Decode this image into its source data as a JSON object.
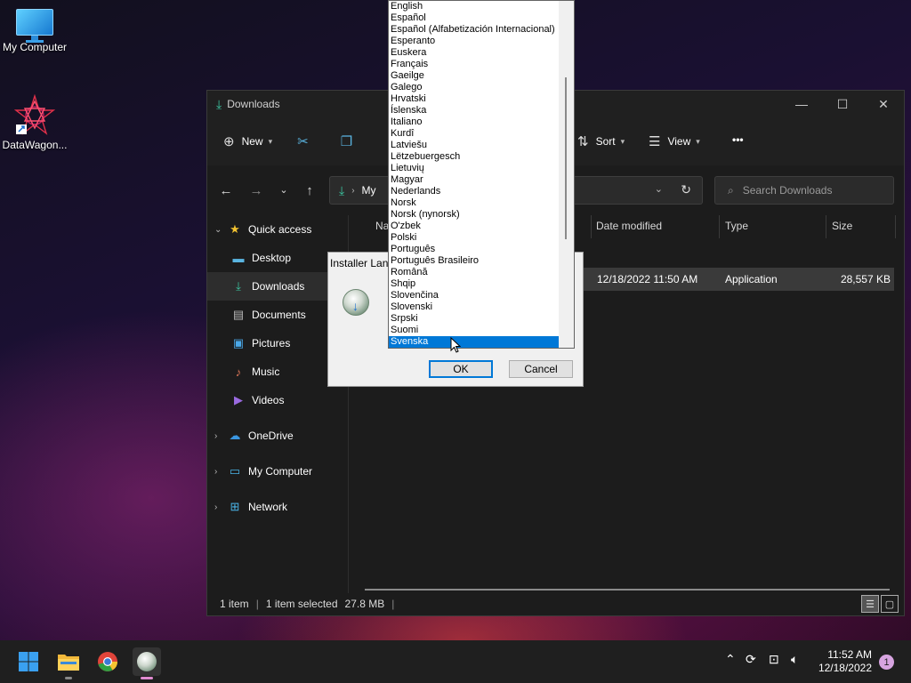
{
  "desktop": {
    "icons": [
      {
        "label": "My Computer"
      },
      {
        "label": "DataWagon..."
      }
    ]
  },
  "explorer": {
    "title": "Downloads",
    "controls": {
      "minimize": "—",
      "maximize": "☐",
      "close": "✕"
    },
    "toolbar": {
      "new_label": "New",
      "sort_label": "Sort",
      "view_label": "View",
      "more_label": "•••"
    },
    "address": {
      "path_label": "My",
      "search_placeholder": "Search Downloads"
    },
    "nav": {
      "items": [
        {
          "label": "Quick access"
        },
        {
          "label": "Desktop"
        },
        {
          "label": "Downloads"
        },
        {
          "label": "Documents"
        },
        {
          "label": "Pictures"
        },
        {
          "label": "Music"
        },
        {
          "label": "Videos"
        },
        {
          "label": "OneDrive"
        },
        {
          "label": "My Computer"
        },
        {
          "label": "Network"
        }
      ]
    },
    "columns": {
      "name": "Na",
      "date_modified": "Date modified",
      "type": "Type",
      "size": "Size"
    },
    "rows": [
      {
        "date_modified": "12/18/2022 11:50 AM",
        "type": "Application",
        "size": "28,557 KB"
      }
    ],
    "status": {
      "count": "1 item",
      "selected": "1 item selected",
      "selected_size": "27.8 MB"
    }
  },
  "installer": {
    "title": "Installer Lang",
    "ok_label": "OK",
    "cancel_label": "Cancel"
  },
  "language_list": {
    "items": [
      "English",
      "Español",
      "Español (Alfabetización Internacional)",
      "Esperanto",
      "Euskera",
      "Français",
      "Gaeilge",
      "Galego",
      "Hrvatski",
      "Íslenska",
      "Italiano",
      "Kurdî",
      "Latviešu",
      "Lëtzebuergesch",
      "Lietuvių",
      "Magyar",
      "Nederlands",
      "Norsk",
      "Norsk (nynorsk)",
      "O'zbek",
      "Polski",
      "Português",
      "Português Brasileiro",
      "Română",
      "Shqip",
      "Slovenčina",
      "Slovenski",
      "Srpski",
      "Suomi",
      "Svenska"
    ],
    "selected": "Svenska",
    "selected_color": "#0078d7"
  },
  "taskbar": {
    "time": "11:52 AM",
    "date": "12/18/2022",
    "notification_count": "1"
  }
}
